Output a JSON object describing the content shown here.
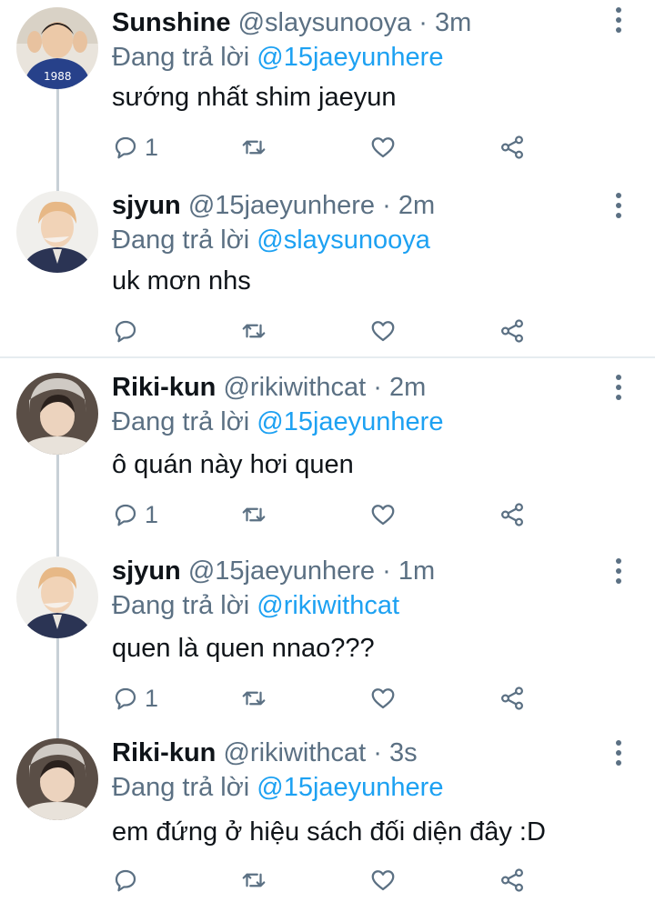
{
  "reply_prefix": "Đang trả lời",
  "tweets": [
    {
      "name": "Sunshine",
      "handle": "@slaysunooya",
      "dot": "·",
      "time": "3m",
      "reply_to": "@15jaeyunhere",
      "text": "sướng nhất shim jaeyun",
      "reply_count": "1",
      "avatar_badge": "1988",
      "avatar_icon": "avatar-sunshine"
    },
    {
      "name": "sjyun",
      "handle": "@15jaeyunhere",
      "dot": "·",
      "time": "2m",
      "reply_to": "@slaysunooya",
      "text": "uk mơn nhs",
      "reply_count": "",
      "avatar_icon": "avatar-sjyun"
    },
    {
      "name": "Riki-kun",
      "handle": "@rikiwithcat",
      "dot": "·",
      "time": "2m",
      "reply_to": "@15jaeyunhere",
      "text": "ô quán này hơi quen",
      "reply_count": "1",
      "avatar_icon": "avatar-riki"
    },
    {
      "name": "sjyun",
      "handle": "@15jaeyunhere",
      "dot": "·",
      "time": "1m",
      "reply_to": "@rikiwithcat",
      "text": "quen là quen nnao???",
      "reply_count": "1",
      "avatar_icon": "avatar-sjyun"
    },
    {
      "name": "Riki-kun",
      "handle": "@rikiwithcat",
      "dot": "·",
      "time": "3s",
      "reply_to": "@15jaeyunhere",
      "text": "em đứng ở hiệu sách đối diện đây :D",
      "reply_count": "",
      "avatar_icon": "avatar-riki"
    }
  ],
  "colors": {
    "accent": "#1da1f2",
    "secondary_text": "#5b7083",
    "primary_text": "#0f1419",
    "divider": "#e6ecf0",
    "thread_line": "#c8d0d6"
  }
}
